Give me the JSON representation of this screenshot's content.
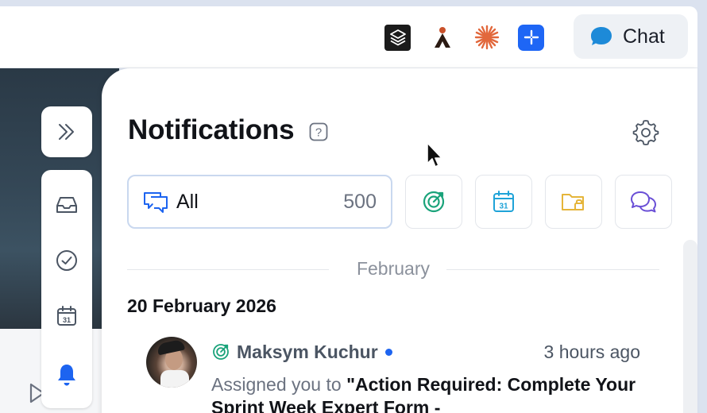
{
  "topbar": {
    "apps": [
      {
        "name": "stack-app",
        "icon": "layers-icon",
        "color": "#1b1b1b"
      },
      {
        "name": "a-app",
        "icon": "a-logo-icon",
        "color": "#2a1a12"
      },
      {
        "name": "burst-app",
        "icon": "burst-icon",
        "color": "#e2683c"
      },
      {
        "name": "blue-app",
        "icon": "sparkle-icon",
        "color": "#1e66f5"
      }
    ],
    "chat_label": "Chat"
  },
  "sidebar": {
    "items": [
      {
        "icon": "inbox-icon"
      },
      {
        "icon": "check-circle-icon"
      },
      {
        "icon": "calendar-icon",
        "text": "31"
      },
      {
        "icon": "bell-icon",
        "active": true
      }
    ]
  },
  "panel": {
    "title": "Notifications",
    "help_symbol": "?",
    "filters": {
      "all_label": "All",
      "all_count": "500",
      "others": [
        {
          "icon": "target-icon",
          "color": "#1aa37a"
        },
        {
          "icon": "calendar-icon",
          "color": "#1fa3d8",
          "text": "31"
        },
        {
          "icon": "folder-lock-icon",
          "color": "#e5b53a"
        },
        {
          "icon": "chat-bubbles-icon",
          "color": "#6a4fd6"
        }
      ]
    },
    "month": "February",
    "date_heading": "20 February 2026",
    "notification": {
      "sender": "Maksym Kuchur",
      "time": "3 hours ago",
      "prefix": "Assigned you to ",
      "title": "\"Action Required: Complete Your Sprint Week Expert Form -"
    }
  },
  "colors": {
    "accent": "#1d64f0",
    "muted_text": "#6b7280"
  }
}
